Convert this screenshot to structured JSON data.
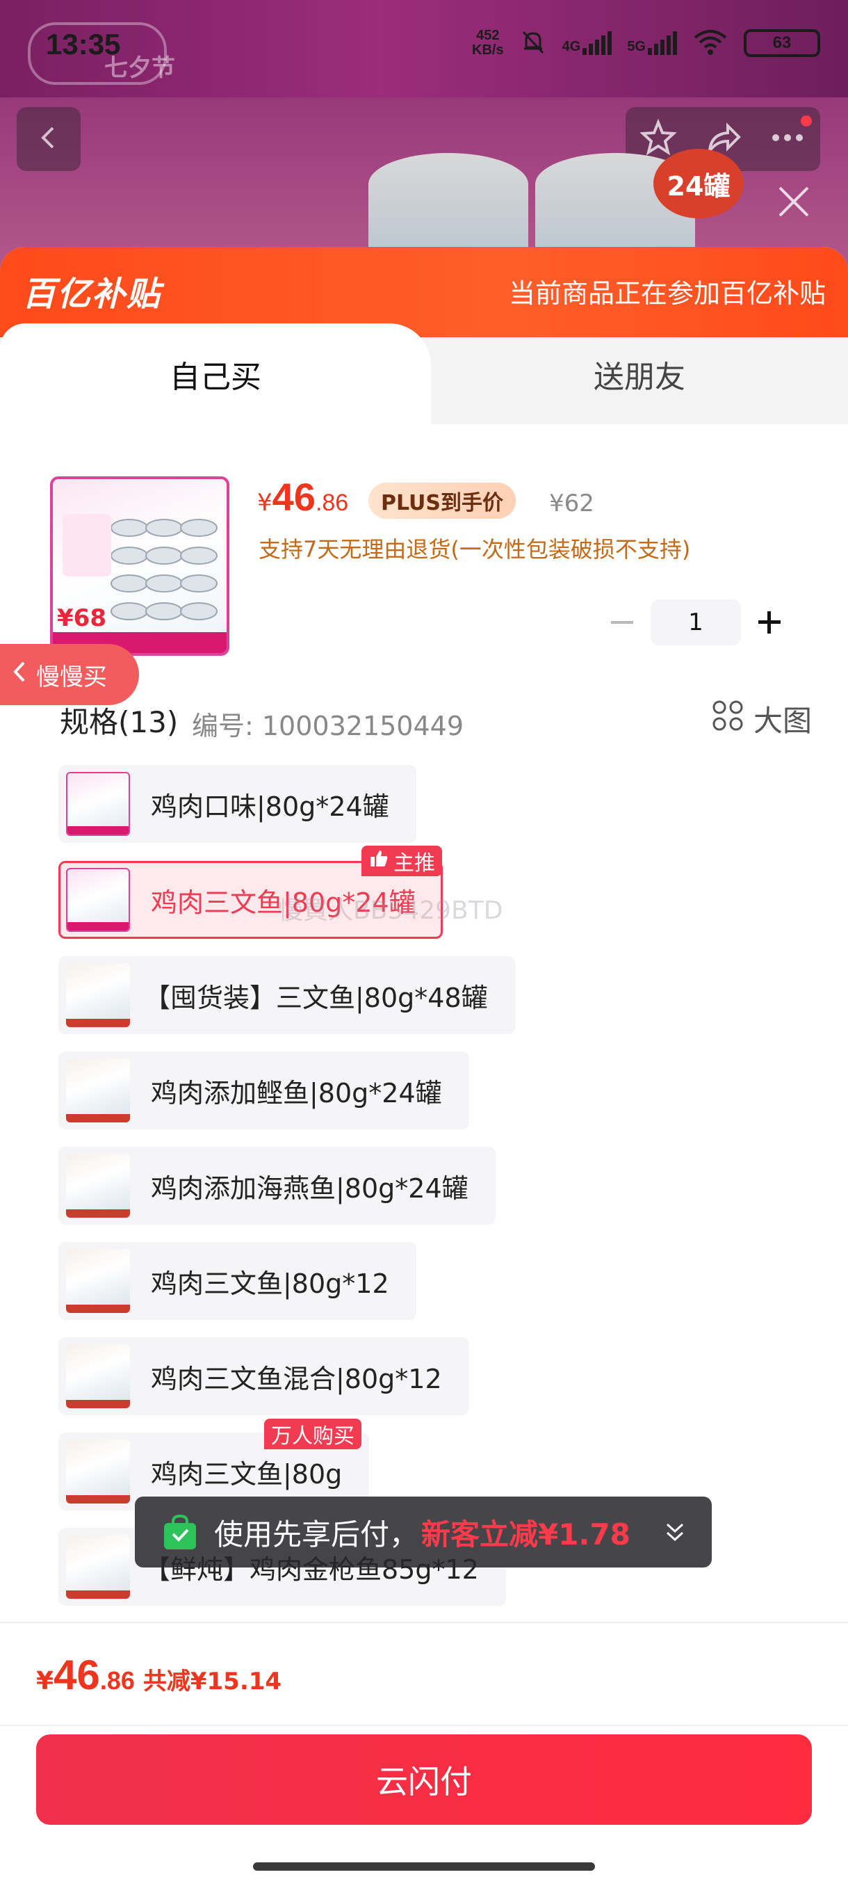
{
  "status_bar": {
    "time": "13:35",
    "net_speed_value": "452",
    "net_speed_unit": "KB/s",
    "signal_1": "4G",
    "signal_2": "5G",
    "battery": "63"
  },
  "background": {
    "festival_label": "七夕节",
    "badge_text": "24罐"
  },
  "subsidy_bar": {
    "logo": "百亿补贴",
    "note": "当前商品正在参加百亿补贴"
  },
  "tabs": [
    {
      "label": "自己买",
      "active": true
    },
    {
      "label": "送朋友",
      "active": false
    }
  ],
  "product": {
    "thumb_price": "¥68",
    "price_symbol": "¥",
    "price_int": "46",
    "price_dec": ".86",
    "plus_tag": "PLUS到手价",
    "original_price": "¥62",
    "return_note": "支持7天无理由退货(一次性包装破损不支持)",
    "quantity": "1"
  },
  "slow_buy": "慢慢买",
  "spec": {
    "heading": "规格(13)",
    "number": "编号: 100032150449",
    "big_picture": "大图",
    "options": [
      {
        "label": "鸡肉口味|80g*24罐"
      },
      {
        "label": "鸡肉三文鱼|80g*24罐",
        "tag": "主推"
      },
      {
        "label": "【囤货装】三文鱼|80g*48罐"
      },
      {
        "label": "鸡肉添加鲣鱼|80g*24罐"
      },
      {
        "label": "鸡肉添加海燕鱼|80g*24罐"
      },
      {
        "label": "鸡肉三文鱼|80g*12"
      },
      {
        "label": "鸡肉三文鱼混合|80g*12"
      },
      {
        "label": "鸡肉三文鱼|80g",
        "tag": "万人购买"
      },
      {
        "label": "【鲜炖】鸡肉金枪鱼85g*12"
      }
    ]
  },
  "watermark": "慢買人BB5429BTD",
  "pay_later": {
    "text": "使用先享后付，",
    "promo": "新客立减¥1.78"
  },
  "footer": {
    "price_symbol": "¥",
    "price_int": "46",
    "price_dec": ".86",
    "savings": "共减¥15.14",
    "button": "云闪付"
  },
  "colors": {
    "accent": "#f0351e",
    "button": "#ff2b3f",
    "selected_border": "#f23a50",
    "subsidy_orange": "#ff5e2b"
  }
}
